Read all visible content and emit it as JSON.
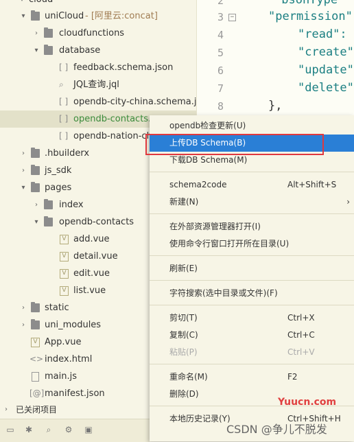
{
  "tree": {
    "root": "cloud",
    "unicloud": "uniCloud",
    "unicloud_tag": "- [阿里云:concat]",
    "cloudfunctions": "cloudfunctions",
    "database": "database",
    "feedback": "feedback.schema.json",
    "jql": "JQL查询.jql",
    "city": "opendb-city-china.schema.j...",
    "contacts": "opendb-contacts.sc",
    "nation": "opendb-nation-chi",
    "hbuilderx": ".hbuilderx",
    "js_sdk": "js_sdk",
    "pages": "pages",
    "index": "index",
    "opendb_contacts": "opendb-contacts",
    "add": "add.vue",
    "detail": "detail.vue",
    "edit": "edit.vue",
    "list": "list.vue",
    "static": "static",
    "uni_modules": "uni_modules",
    "app_vue": "App.vue",
    "index_html": "index.html",
    "main_js": "main.js",
    "manifest": "manifest.json"
  },
  "closed_projects": "已关闭项目",
  "editor": {
    "line_numbers": [
      "2",
      "3",
      "4",
      "5",
      "6",
      "7",
      "8"
    ],
    "lines": [
      "\"bsonType\" :",
      "\"permission\"",
      "\"read\":",
      "\"create\"",
      "\"update\"",
      "\"delete\"",
      "},"
    ]
  },
  "menu": {
    "check_update": "opendb检查更新(U)",
    "upload_schema": "上传DB Schema(B)",
    "download_schema": "下载DB Schema(M)",
    "schema2code": "schema2code",
    "schema2code_shortcut": "Alt+Shift+S",
    "new": "新建(N)",
    "open_explorer": "在外部资源管理器打开(I)",
    "open_cmd": "使用命令行窗口打开所在目录(U)",
    "refresh": "刷新(E)",
    "search": "字符搜索(选中目录或文件)(F)",
    "cut": "剪切(T)",
    "cut_shortcut": "Ctrl+X",
    "copy": "复制(C)",
    "copy_shortcut": "Ctrl+C",
    "paste": "粘贴(P)",
    "paste_shortcut": "Ctrl+V",
    "rename": "重命名(M)",
    "rename_shortcut": "F2",
    "delete": "删除(D)",
    "history": "本地历史记录(Y)",
    "history_shortcut": "Ctrl+Shift+H"
  },
  "watermark": {
    "site": "Yuucn.com",
    "author": "CSDN @争儿不脱发"
  },
  "colors": {
    "highlight": "#2a7fd6",
    "annotation_box": "#e0383e",
    "code_teal": "#1b7f82"
  }
}
